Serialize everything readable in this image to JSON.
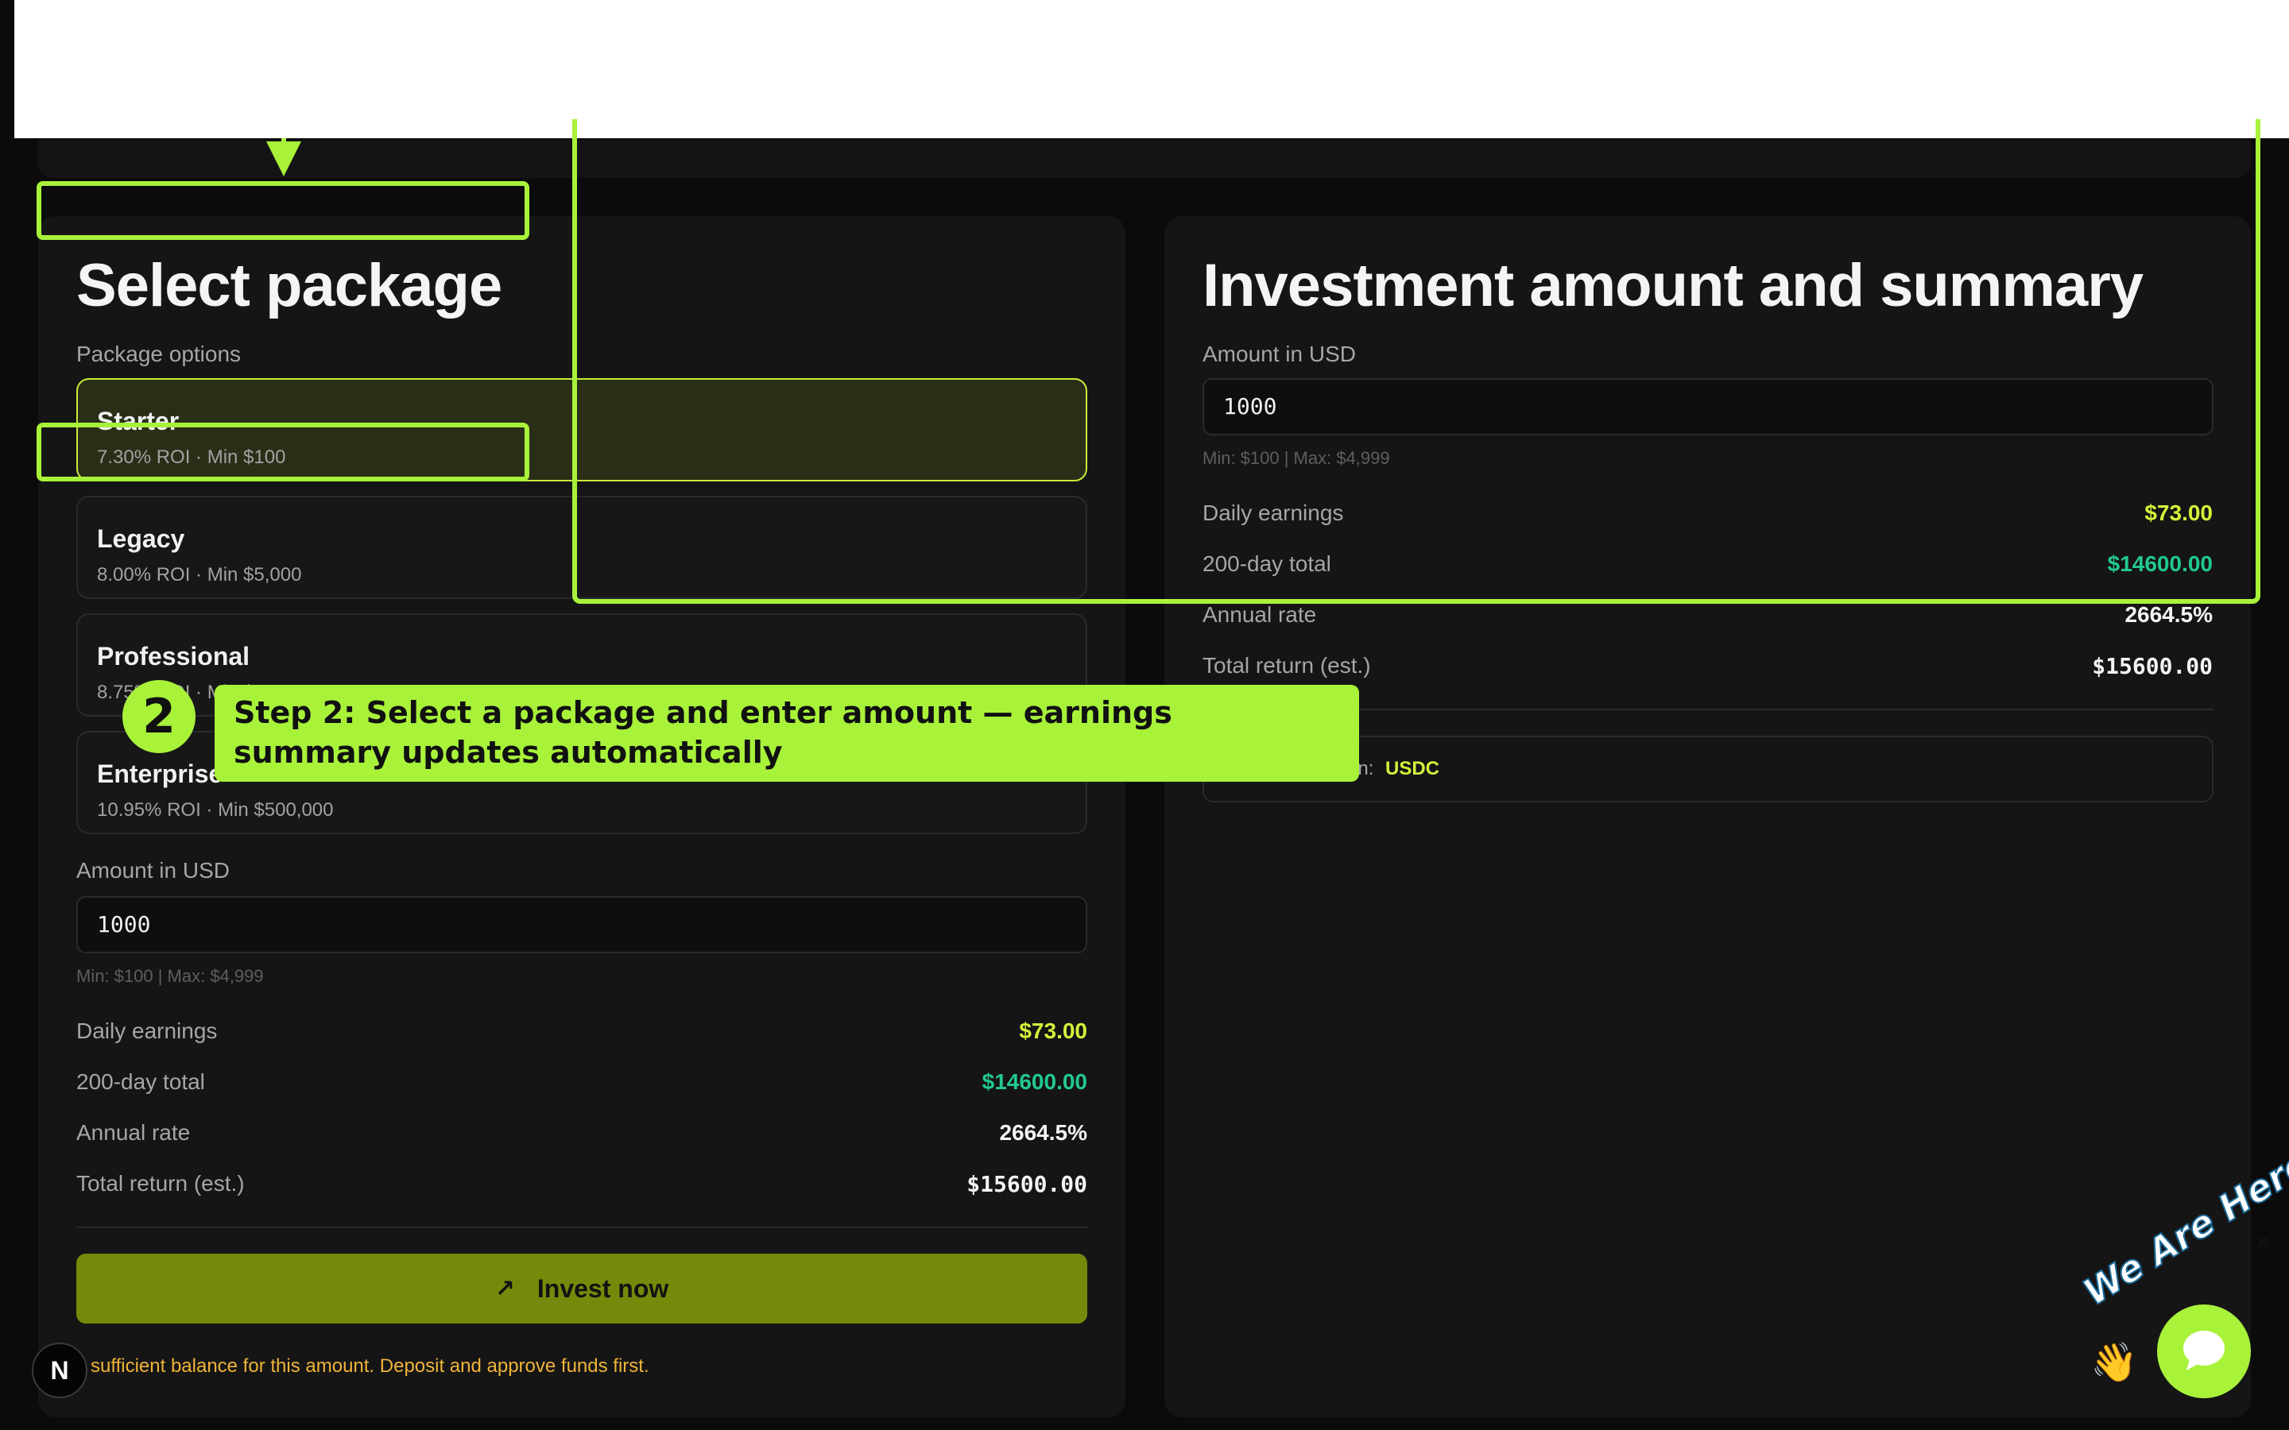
{
  "left_panel": {
    "title": "Select package",
    "package_options_label": "Package options",
    "packages": [
      {
        "name": "Starter",
        "meta": "7.30% ROI · Min $100",
        "selected": true
      },
      {
        "name": "Legacy",
        "meta": "8.00% ROI · Min $5,000",
        "selected": false
      },
      {
        "name": "Professional",
        "meta": "8.75% ROI · Min $50,000",
        "selected": false
      },
      {
        "name": "Enterprise",
        "meta": "10.95% ROI · Min $500,000",
        "selected": false
      }
    ],
    "amount_label": "Amount in USD",
    "amount_value": "1000",
    "amount_hint": "Min: $100 | Max: $4,999",
    "summary": {
      "daily_label": "Daily earnings",
      "daily_value": "$73.00",
      "total200_label": "200-day total",
      "total200_value": "$14600.00",
      "annual_label": "Annual rate",
      "annual_value": "2664.5%",
      "return_label": "Total return (est.)",
      "return_value": "$15600.00"
    },
    "invest_button": "Invest now",
    "warning": "sufficient balance for this amount. Deposit and approve funds first."
  },
  "right_panel": {
    "title": "Investment amount and summary",
    "amount_label": "Amount in USD",
    "amount_value": "1000",
    "amount_hint": "Min: $100 | Max: $4,999",
    "summary": {
      "daily_label": "Daily earnings",
      "daily_value": "$73.00",
      "total200_label": "200-day total",
      "total200_value": "$14600.00",
      "annual_label": "Annual rate",
      "annual_value": "2664.5%",
      "return_label": "Total return (est.)",
      "return_value": "$15600.00"
    },
    "token_label_partial": "en:",
    "token_value": "USDC"
  },
  "annotation": {
    "step_number": "2",
    "step_text": "Step 2: Select a package and enter amount — earnings summary updates automatically"
  },
  "widgets": {
    "n_badge": "N",
    "chat_tagline": "We Are Here!",
    "chat_close": "×"
  },
  "colors": {
    "accent": "#a8f23a",
    "daily": "#d4f23a",
    "total200": "#22c98e",
    "warning": "#f0b43a",
    "invest_button": "#748a0b"
  }
}
